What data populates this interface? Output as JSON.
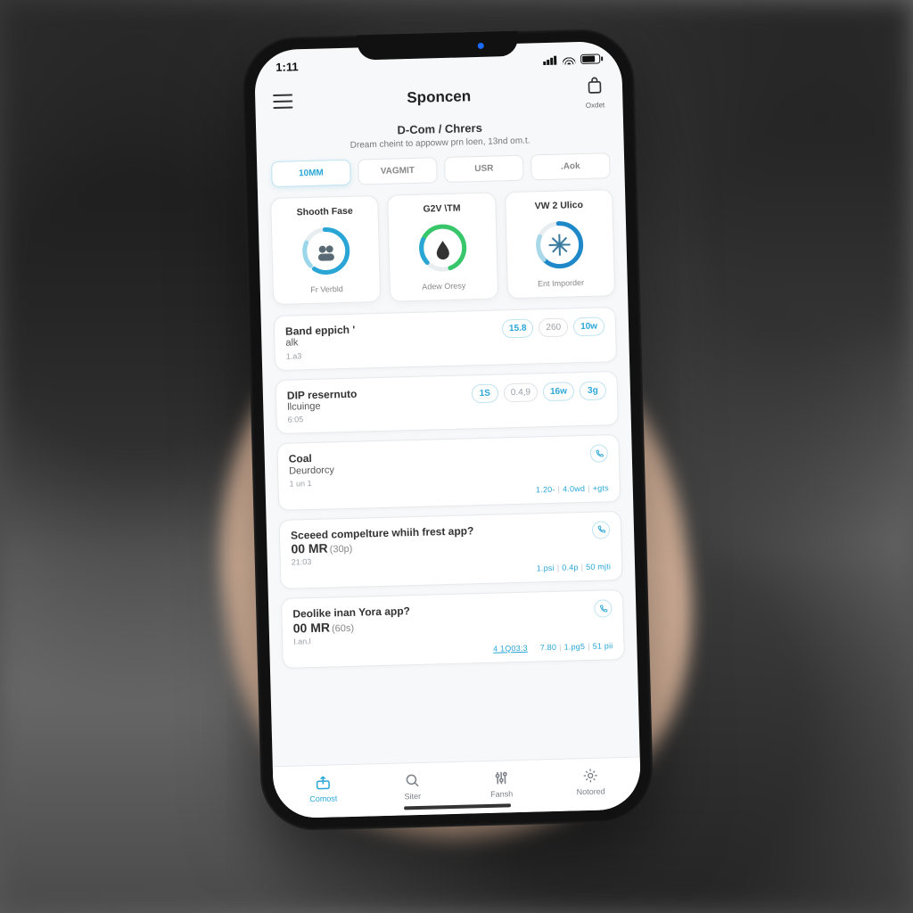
{
  "status": {
    "time": "1:11"
  },
  "header": {
    "title": "Sponcen",
    "cart_label": "Oxdet"
  },
  "sub_header": {
    "title": "D-Com / Chrers",
    "desc": "Dream cheint to appoww prn loen, 13nd om.t."
  },
  "tabs": [
    {
      "label": "10MM",
      "active": true
    },
    {
      "label": "VAGMIT",
      "active": false
    },
    {
      "label": "USR",
      "active": false
    },
    {
      "label": ".Aok",
      "active": false
    }
  ],
  "gauges": [
    {
      "title": "Shooth Fase",
      "label": "Fr Verbld",
      "color1": "#2aa6d6",
      "color2": "#9ad7eb",
      "arc": 300,
      "dash": "60 40",
      "center_icon": "people"
    },
    {
      "title": "G2V \\TM",
      "label": "Adew Oresy",
      "color1": "#37c76a",
      "color2": "#2aa6d6",
      "arc": 260,
      "dash": "45 20 35",
      "center_icon": "drop"
    },
    {
      "title": "VW 2 Ulico",
      "label": "Ent Imporder",
      "color1": "#1e88c9",
      "color2": "#a9d8e9",
      "arc": 320,
      "dash": "70 30",
      "center_icon": "snow"
    }
  ],
  "rows": [
    {
      "title": "Band eppich '",
      "subtitle": "alk",
      "sub2": "1.a3",
      "pills": [
        {
          "text": "15.8",
          "muted": false
        },
        {
          "text": "260",
          "muted": true
        },
        {
          "text": "10w",
          "muted": false
        }
      ],
      "type": "pills"
    },
    {
      "title": "DIP resernuto",
      "subtitle": "llcuinge",
      "sub2": "6:05",
      "pills": [
        {
          "text": "1S",
          "muted": false
        },
        {
          "text": "0.4,9",
          "muted": true
        },
        {
          "text": "16w",
          "muted": false
        },
        {
          "text": "3g",
          "muted": false
        }
      ],
      "type": "pills"
    },
    {
      "title": "Coal",
      "subtitle": "Deurdorcy",
      "sub2": "1 un 1",
      "footer": [
        "1.20-",
        "4.0wd",
        "+gts"
      ],
      "type": "call"
    },
    {
      "title": "Sceeed compelture whiih frest app?",
      "big_value": "00 MR",
      "big_paren": "(30p)",
      "sub2": "21:03",
      "footer": [
        "1.psi",
        "0.4p",
        "50 mjti"
      ],
      "type": "call_big"
    },
    {
      "title": "Deolike inan Yora app?",
      "big_value": "00 MR",
      "big_paren": "(60s)",
      "sub2": "I.an.l",
      "link": "4 1Q03:3",
      "footer": [
        "7.80",
        "1.pg5",
        "51 pii"
      ],
      "type": "call_big"
    }
  ],
  "nav": [
    {
      "label": "Comost",
      "icon": "upload",
      "active": true
    },
    {
      "label": "Siter",
      "icon": "search",
      "active": false
    },
    {
      "label": "Fansh",
      "icon": "sliders",
      "active": false
    },
    {
      "label": "Notored",
      "icon": "sparkle",
      "active": false
    }
  ],
  "colors": {
    "accent": "#2aa6d6"
  }
}
